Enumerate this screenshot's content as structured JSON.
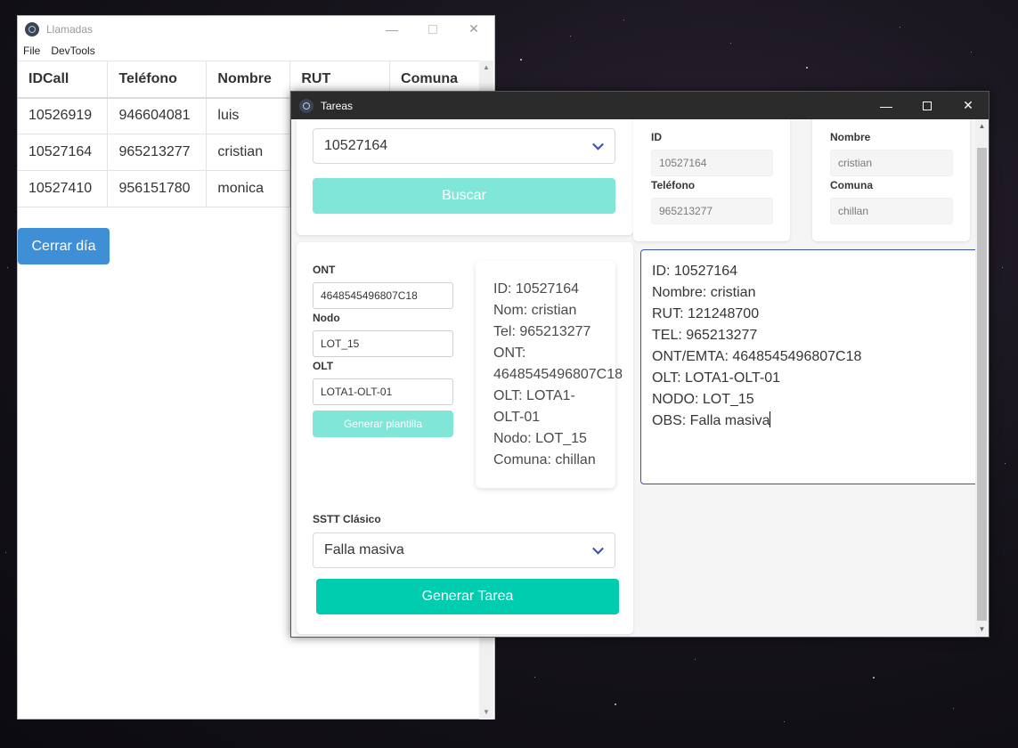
{
  "calls_window": {
    "title": "Llamadas",
    "menu": [
      "File",
      "DevTools"
    ],
    "table": {
      "headers": [
        "IDCall",
        "Teléfono",
        "Nombre",
        "RUT",
        "Comuna"
      ],
      "rows": [
        [
          "10526919",
          "946604081",
          "luis"
        ],
        [
          "10527164",
          "965213277",
          "cristian"
        ],
        [
          "10527410",
          "956151780",
          "monica"
        ]
      ]
    },
    "close_day_button": "Cerrar día"
  },
  "tasks_window": {
    "title": "Tareas",
    "id_select_value": "10527164",
    "search_button": "Buscar",
    "client": {
      "id_label": "ID",
      "id_value": "10527164",
      "name_label": "Nombre",
      "name_value": "cristian",
      "phone_label": "Teléfono",
      "phone_value": "965213277",
      "comuna_label": "Comuna",
      "comuna_value": "chillan"
    },
    "network": {
      "ont_label": "ONT",
      "ont_value": "4648545496807C18",
      "nodo_label": "Nodo",
      "nodo_value": "LOT_15",
      "olt_label": "OLT",
      "olt_value": "LOTA1-OLT-01",
      "template_button": "Generar plantilla"
    },
    "summary_lines": [
      "ID: 10527164",
      "Nom: cristian",
      "Tel: 965213277",
      "ONT:",
      "4648545496807C18",
      "OLT: LOTA1-",
      "OLT-01",
      "Nodo: LOT_15",
      "Comuna: chillan"
    ],
    "template_text_lines": [
      "ID: 10527164",
      "Nombre: cristian",
      "RUT: 121248700",
      "TEL: 965213277",
      "ONT/EMTA: 4648545496807C18",
      "OLT: LOTA1-OLT-01",
      "NODO: LOT_15",
      "OBS: Falla masiva"
    ],
    "sstt_label": "SSTT Clásico",
    "sstt_value": "Falla masiva",
    "generate_task_button": "Generar Tarea"
  },
  "colors": {
    "teal_primary": "#00ccb0",
    "teal_disabled": "#7fe6d8",
    "blue_button": "#3e8fd6",
    "focus_border": "#3850b8",
    "dark_titlebar": "#2b2b2b"
  },
  "icons": {
    "app": "electron-app-icon",
    "minimize": "minimize-icon",
    "maximize": "maximize-icon",
    "close": "close-icon",
    "dropdown": "chevron-down-icon"
  }
}
